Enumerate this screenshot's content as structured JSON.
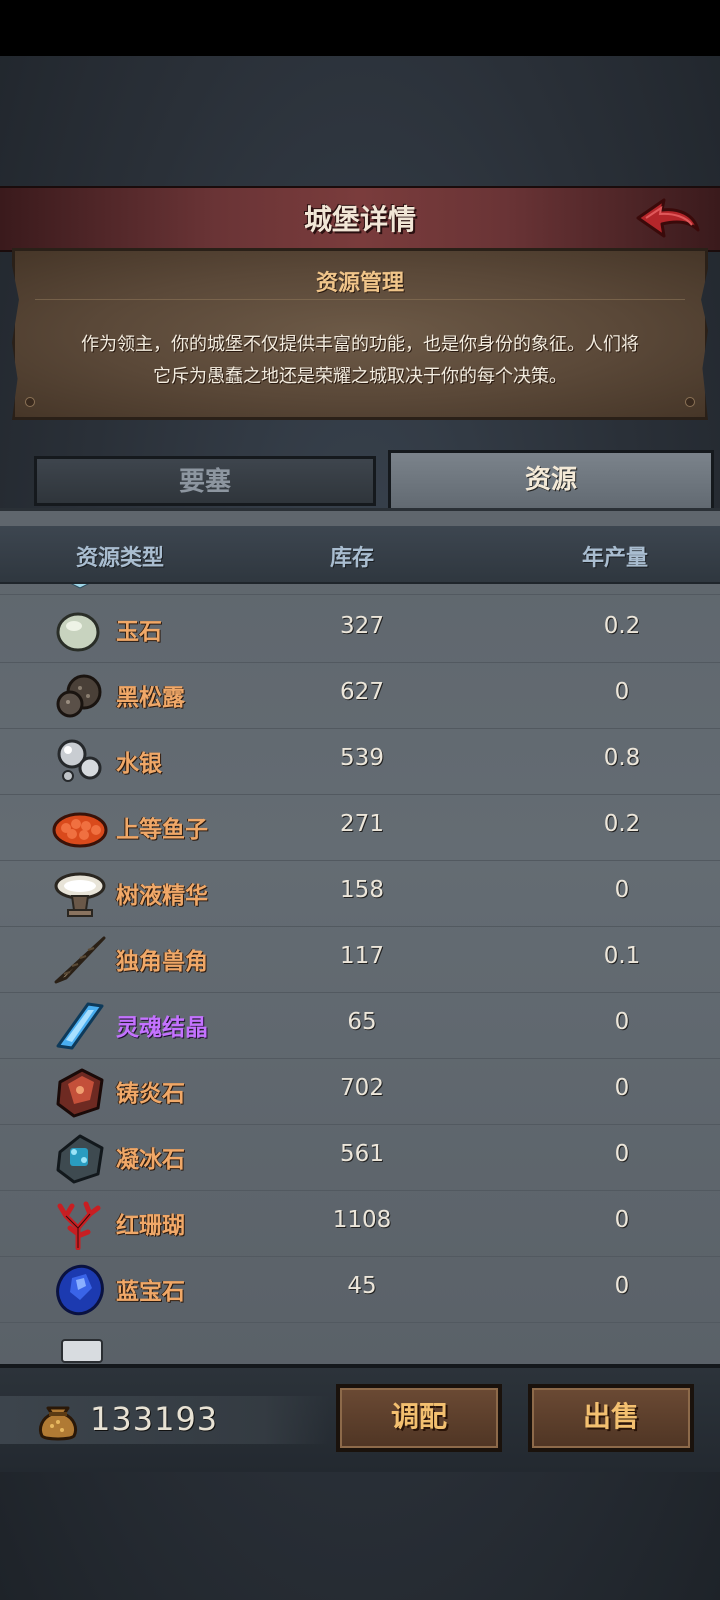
{
  "header": {
    "title": "城堡详情",
    "back_icon": "back-arrow-icon"
  },
  "info": {
    "title": "资源管理",
    "description_line1": "作为领主，你的城堡不仅提供丰富的功能，也是你身份的象征。人们将",
    "description_line2": "它斥为愚蠢之地还是荣耀之城取决于你的每个决策。"
  },
  "tabs": [
    {
      "label": "要塞",
      "active": false
    },
    {
      "label": "资源",
      "active": true
    }
  ],
  "table": {
    "columns": [
      "资源类型",
      "库存",
      "年产量"
    ],
    "rows": [
      {
        "icon": "jade-icon",
        "name": "玉石",
        "stock": "327",
        "yearly": "0.2"
      },
      {
        "icon": "black-truffle-icon",
        "name": "黑松露",
        "stock": "627",
        "yearly": "0"
      },
      {
        "icon": "mercury-icon",
        "name": "水银",
        "stock": "539",
        "yearly": "0.8"
      },
      {
        "icon": "caviar-icon",
        "name": "上等鱼子",
        "stock": "271",
        "yearly": "0.2"
      },
      {
        "icon": "sap-essence-icon",
        "name": "树液精华",
        "stock": "158",
        "yearly": "0"
      },
      {
        "icon": "unicorn-horn-icon",
        "name": "独角兽角",
        "stock": "117",
        "yearly": "0.1"
      },
      {
        "icon": "soul-crystal-icon",
        "name": "灵魂结晶",
        "stock": "65",
        "yearly": "0",
        "rarity_color": "#c472ff"
      },
      {
        "icon": "forge-stone-icon",
        "name": "铸炎石",
        "stock": "702",
        "yearly": "0"
      },
      {
        "icon": "frost-stone-icon",
        "name": "凝冰石",
        "stock": "561",
        "yearly": "0"
      },
      {
        "icon": "red-coral-icon",
        "name": "红珊瑚",
        "stock": "1108",
        "yearly": "0"
      },
      {
        "icon": "sapphire-icon",
        "name": "蓝宝石",
        "stock": "45",
        "yearly": "0"
      }
    ]
  },
  "footer": {
    "gold_icon": "gold-sack-icon",
    "gold_amount": "133193",
    "allocate_label": "调配",
    "sell_label": "出售"
  },
  "colors": {
    "resource_name": "#f0a868",
    "rare_resource_name": "#c472ff",
    "header_bar": "#6a3436",
    "button_text": "#f3c070"
  }
}
